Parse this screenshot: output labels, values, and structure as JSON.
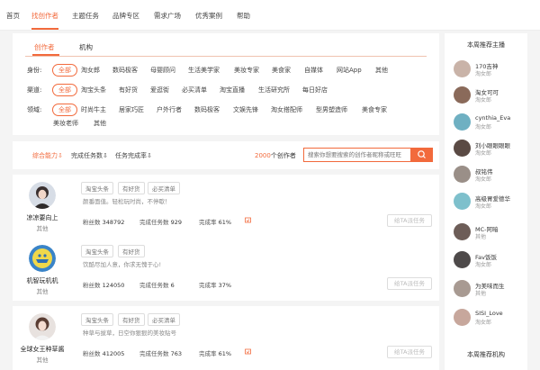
{
  "topnav": {
    "items": [
      "首页",
      "找创作者",
      "主题任务",
      "品牌专区",
      "需求广场",
      "优秀案例",
      "帮助"
    ],
    "active_index": 1
  },
  "filter": {
    "tabs": [
      "创作者",
      "机构"
    ],
    "active_tab": 0,
    "rows": [
      {
        "label": "身份:",
        "options": [
          "全部",
          "淘女郎",
          "数码极客",
          "母婴顾问",
          "生活美学家",
          "美妆专家",
          "美食家",
          "自媒体",
          "网站App",
          "其他"
        ]
      },
      {
        "label": "渠道:",
        "options": [
          "全部",
          "淘宝头条",
          "有好货",
          "爱逛街",
          "必买清单",
          "淘宝直播",
          "生活研究所",
          "每日好店"
        ]
      },
      {
        "label": "领域:",
        "options": [
          "全部",
          "时尚牛主",
          "居家巧匠",
          "户外行者",
          "数码极客",
          "文娱先锋",
          "淘女搭配师",
          "型男塑造师",
          "美食专家",
          "美妆老师",
          "其他"
        ]
      }
    ]
  },
  "sort": {
    "items": [
      "综合能力⇩",
      "完成任务数⇩",
      "任务完成率⇩"
    ],
    "active_index": 0,
    "count_num": "2000",
    "count_suffix": "个创作者",
    "search_placeholder": "搜索你想要搜索的创作者昵称或旺旺"
  },
  "cards": [
    {
      "name": "凉凉要向上",
      "type": "其他",
      "tags": [
        "淘宝头条",
        "有好货",
        "必买清单"
      ],
      "desc": "颜番面值。轻松玩时尚，不停歇！",
      "fans_label": "粉丝数",
      "fans": "348792",
      "tasks_label": "完成任务数",
      "tasks": "929",
      "rate_label": "完成率",
      "rate": "61%",
      "btn": "给TA派任务"
    },
    {
      "name": "机智玩机机",
      "type": "其他",
      "tags": [
        "淘宝头条",
        "有好货"
      ],
      "desc": "饮酷尽加人意，你求无愧于心!",
      "fans_label": "粉丝数",
      "fans": "124050",
      "tasks_label": "完成任务数",
      "tasks": "6",
      "rate_label": "完成率",
      "rate": "37%",
      "btn": "给TA派任务"
    },
    {
      "name": "全球女王种草酱",
      "type": "其他",
      "tags": [
        "淘宝头条",
        "有好货",
        "必买清单"
      ],
      "desc": "种草与拔草，日空你狠狠的美妆贴号",
      "fans_label": "粉丝数",
      "fans": "412005",
      "tasks_label": "完成任务数",
      "tasks": "763",
      "rate_label": "完成率",
      "rate": "61%",
      "btn": "给TA派任务"
    }
  ],
  "sidebar": {
    "title": "本周推荐主播",
    "items": [
      {
        "name": "170吉神",
        "type": "淘女郎"
      },
      {
        "name": "淘女可可",
        "type": "淘女郎"
      },
      {
        "name": "cynthia_Eva",
        "type": "淘女郎"
      },
      {
        "name": "刘小眼眼眼眼",
        "type": "淘女郎"
      },
      {
        "name": "叔铭伟",
        "type": "淘女郎"
      },
      {
        "name": "高级胃爱德华",
        "type": "淘女郎"
      },
      {
        "name": "MC-阿暗",
        "type": "其他"
      },
      {
        "name": "Fav饭饭",
        "type": "淘女郎"
      },
      {
        "name": "为美味而生",
        "type": "其他"
      },
      {
        "name": "SISI_Love",
        "type": "淘女郎"
      }
    ],
    "bottom_title": "本周推荐机构"
  },
  "colors": {
    "accent": "#f26a3c"
  }
}
